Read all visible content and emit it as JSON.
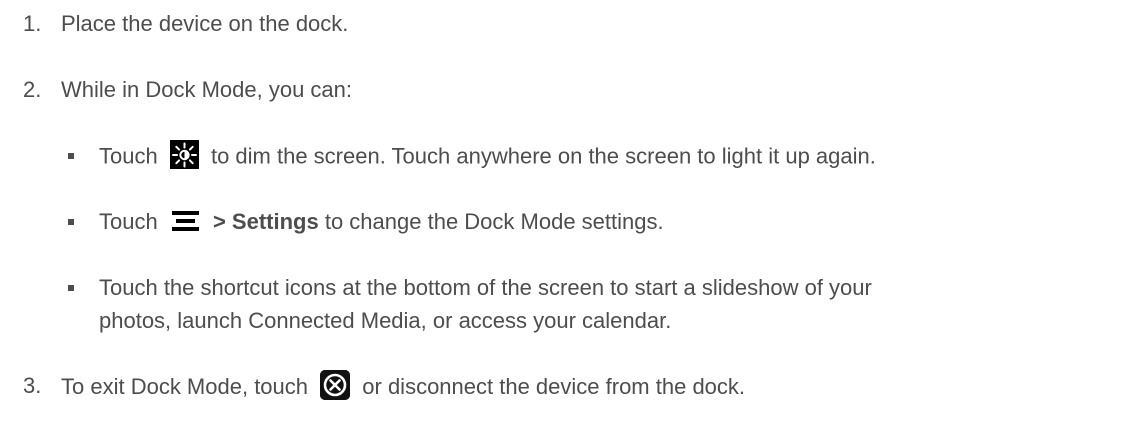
{
  "steps": [
    {
      "number": "1.",
      "text": "Place the device on the dock."
    },
    {
      "number": "2.",
      "text": "While in Dock Mode, you can:"
    },
    {
      "number": "3.",
      "text_before": "To exit Dock Mode, touch",
      "icon": "close-circle-icon",
      "text_after": "or disconnect the device from the dock."
    }
  ],
  "bullets": [
    {
      "text_before": "Touch",
      "icon": "brightness-dim-icon",
      "text_after": "to dim the screen. Touch anywhere on the screen to light it up again."
    },
    {
      "text_before": "Touch",
      "icon": "menu-icon",
      "bold": "> Settings",
      "text_after": "to change the Dock Mode settings."
    },
    {
      "line1": "Touch the shortcut icons at the bottom of the screen to start a slideshow of your",
      "line2": "photos, launch Connected Media, or access your calendar."
    }
  ],
  "colors": {
    "text": "#4d4d4d",
    "icon_bg": "#000000",
    "icon_fg": "#ffffff"
  }
}
